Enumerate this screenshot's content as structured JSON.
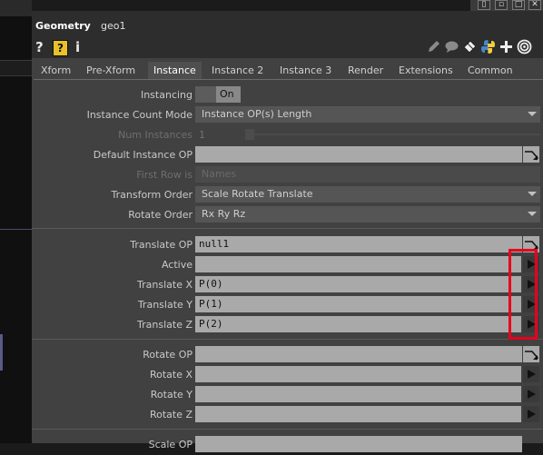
{
  "panel": {
    "type": "Geometry",
    "name": "geo1"
  },
  "toolbar": {
    "help_icon": "?",
    "help_box_icon": "?",
    "info_icon": "i"
  },
  "tabs": [
    {
      "label": "Xform",
      "active": false
    },
    {
      "label": "Pre-Xform",
      "active": false
    },
    {
      "label": "Instance",
      "active": true
    },
    {
      "label": "Instance 2",
      "active": false
    },
    {
      "label": "Instance 3",
      "active": false
    },
    {
      "label": "Render",
      "active": false
    },
    {
      "label": "Extensions",
      "active": false
    },
    {
      "label": "Common",
      "active": false
    }
  ],
  "params": {
    "instancing": {
      "label": "Instancing",
      "value": "On"
    },
    "count_mode": {
      "label": "Instance Count Mode",
      "value": "Instance OP(s) Length"
    },
    "num_instances": {
      "label": "Num Instances",
      "value": "1"
    },
    "default_instance_op": {
      "label": "Default Instance OP",
      "value": ""
    },
    "first_row_is": {
      "label": "First Row is",
      "value": "Names"
    },
    "transform_order": {
      "label": "Transform Order",
      "value": "Scale Rotate Translate"
    },
    "rotate_order": {
      "label": "Rotate Order",
      "value": "Rx Ry Rz"
    },
    "translate_op": {
      "label": "Translate OP",
      "value": "null1"
    },
    "active": {
      "label": "Active",
      "value": ""
    },
    "translate_x": {
      "label": "Translate X",
      "value": "P(0)"
    },
    "translate_y": {
      "label": "Translate Y",
      "value": "P(1)"
    },
    "translate_z": {
      "label": "Translate Z",
      "value": "P(2)"
    },
    "rotate_op": {
      "label": "Rotate OP",
      "value": ""
    },
    "rotate_x": {
      "label": "Rotate X",
      "value": ""
    },
    "rotate_y": {
      "label": "Rotate Y",
      "value": ""
    },
    "rotate_z": {
      "label": "Rotate Z",
      "value": ""
    },
    "scale_op": {
      "label": "Scale OP",
      "value": ""
    }
  },
  "colors": {
    "highlight": "#e8001c",
    "field": "#a9a9a9",
    "panel_bg": "#414141"
  }
}
